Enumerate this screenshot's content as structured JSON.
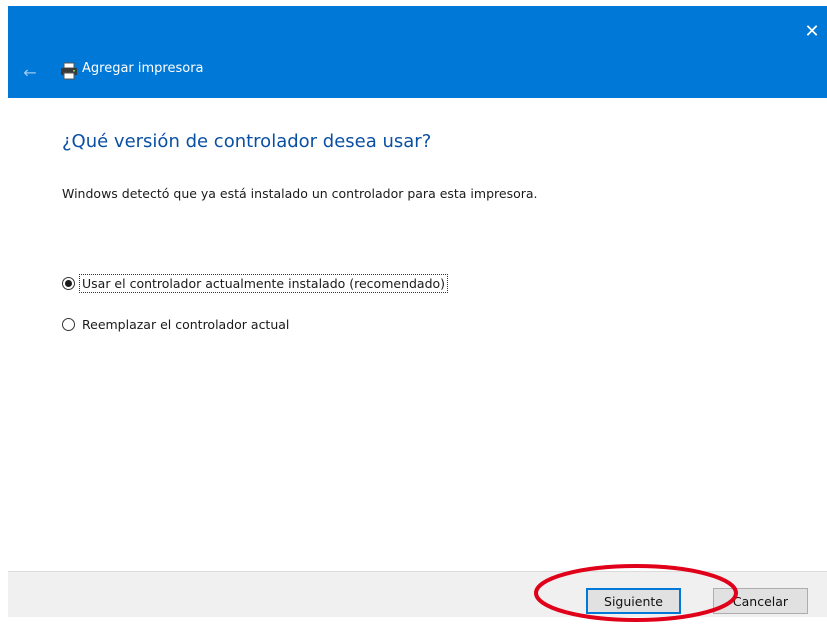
{
  "window": {
    "title": "Agregar impresora",
    "close_glyph": "✕",
    "back_glyph": "←"
  },
  "page": {
    "heading": "¿Qué versión de controlador desea usar?",
    "description": "Windows detectó que ya está instalado un controlador para esta impresora."
  },
  "options": [
    {
      "label": "Usar el controlador actualmente instalado (recomendado)",
      "selected": true
    },
    {
      "label": "Reemplazar el controlador actual",
      "selected": false
    }
  ],
  "buttons": {
    "next": "Siguiente",
    "cancel": "Cancelar"
  },
  "colors": {
    "header": "#0078d7",
    "heading": "#0a4fa3",
    "annotation": "#e0001a"
  },
  "icons": {
    "title_icon": "printer-icon",
    "back": "back-arrow-icon",
    "close": "close-icon"
  }
}
